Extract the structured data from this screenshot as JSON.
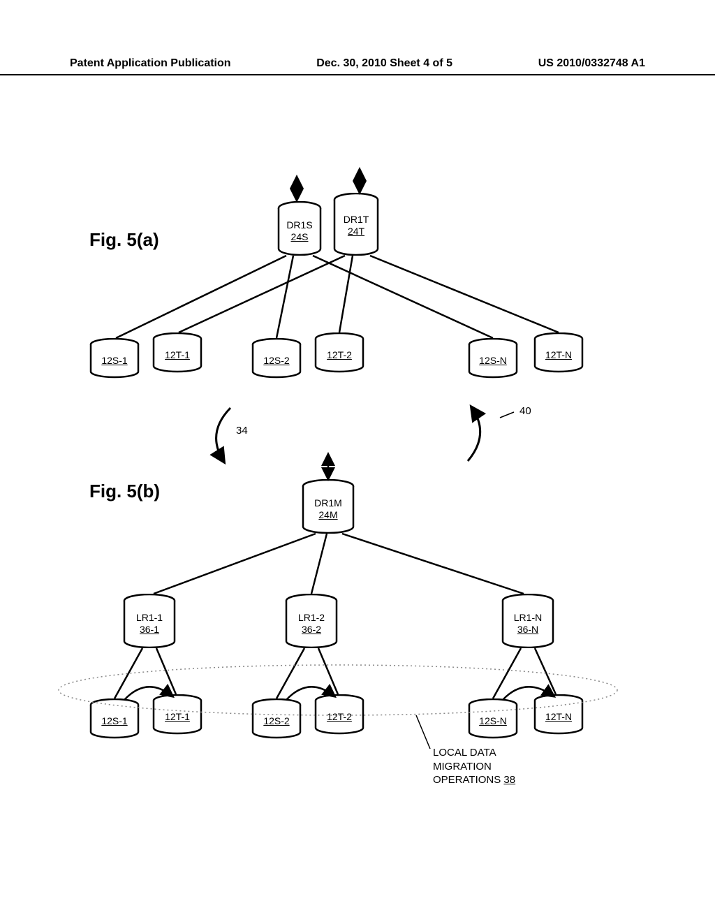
{
  "header": {
    "left": "Patent Application Publication",
    "mid": "Dec. 30, 2010  Sheet 4 of 5",
    "right": "US 2010/0332748 A1"
  },
  "figA": {
    "label": "Fig. 5(a)"
  },
  "figB": {
    "label": "Fig. 5(b)"
  },
  "dr1s": {
    "name": "DR1S",
    "ref": "24S"
  },
  "dr1t": {
    "name": "DR1T",
    "ref": "24T"
  },
  "dr1m": {
    "name": "DR1M",
    "ref": "24M"
  },
  "a": {
    "s1": "12S-1",
    "t1": "12T-1",
    "s2": "12S-2",
    "t2": "12T-2",
    "sn": "12S-N",
    "tn": "12T-N"
  },
  "lr": {
    "l1name": "LR1-1",
    "l1ref": "36-1",
    "l2name": "LR1-2",
    "l2ref": "36-2",
    "lnname": "LR1-N",
    "lnref": "36-N"
  },
  "b": {
    "s1": "12S-1",
    "t1": "12T-1",
    "s2": "12S-2",
    "t2": "12T-2",
    "sn": "12S-N",
    "tn": "12T-N"
  },
  "call34": "34",
  "call40": "40",
  "annot": {
    "l1": "LOCAL DATA",
    "l2": "MIGRATION",
    "l3": "OPERATIONS",
    "l3ref": "38"
  }
}
